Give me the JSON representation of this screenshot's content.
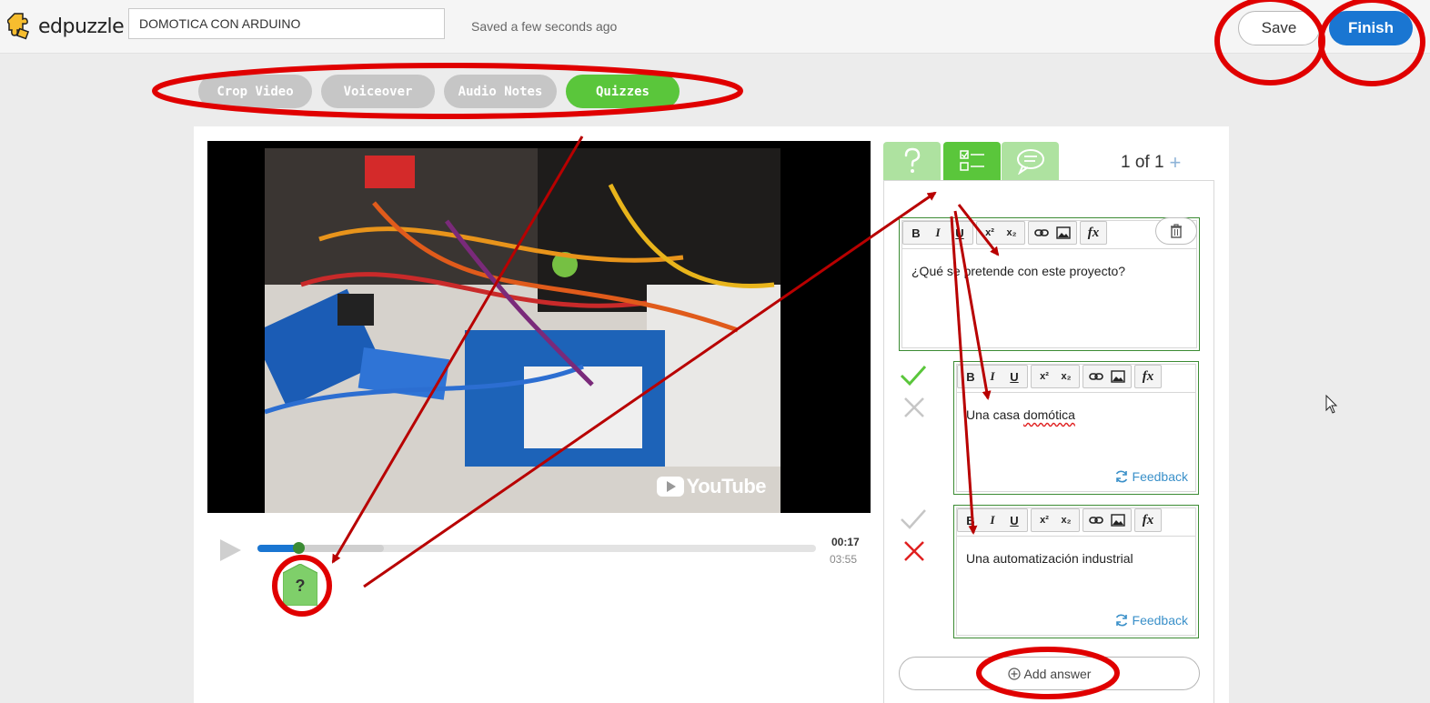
{
  "header": {
    "brand": "edpuzzle",
    "title_value": "DOMOTICA CON ARDUINO",
    "saved_status": "Saved a few seconds ago",
    "save_label": "Save",
    "finish_label": "Finish"
  },
  "tool_tabs": [
    {
      "label": "Crop Video",
      "active": false
    },
    {
      "label": "Voiceover",
      "active": false
    },
    {
      "label": "Audio Notes",
      "active": false
    },
    {
      "label": "Quizzes",
      "active": true
    }
  ],
  "video": {
    "watermark": "YouTube",
    "current_time": "00:17",
    "total_time": "03:55",
    "progress": 0.074,
    "buffered": 0.226,
    "question_marker": "?"
  },
  "question": {
    "tab_icons": [
      "question-mark-icon",
      "checklist-icon",
      "speech-bubble-icon"
    ],
    "active_tab": 1,
    "counter": "1 of 1",
    "add_symbol": "+",
    "text": "¿Qué se pretende con este proyecto?"
  },
  "toolbar": {
    "bold": "B",
    "italic": "I",
    "underline": "U",
    "superscript": "x²",
    "subscript": "x₂",
    "formula": "fx"
  },
  "answers": [
    {
      "text_before": "Una casa ",
      "text_flagged": "domótica",
      "correct": true,
      "feedback_label": "Feedback"
    },
    {
      "text_before": "Una automatización industrial",
      "text_flagged": "",
      "correct": false,
      "feedback_label": "Feedback"
    }
  ],
  "add_answer_label": "Add answer",
  "colors": {
    "brand_yellow": "#f6bd2f",
    "accent_green": "#5ac63b",
    "accent_blue": "#1a76d2",
    "annotation_red": "#e00000",
    "arrow_red": "#b80000"
  }
}
